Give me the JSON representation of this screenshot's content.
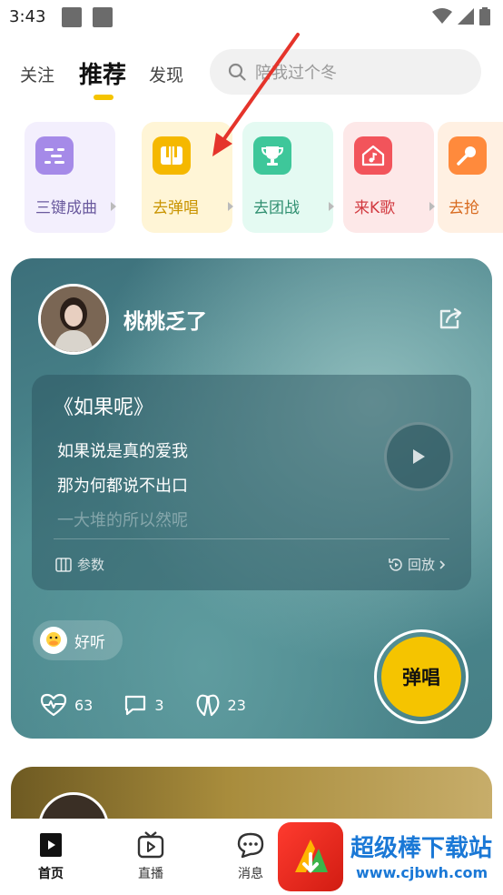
{
  "status_bar": {
    "time": "3:43"
  },
  "top_nav": {
    "tabs": [
      {
        "label": "关注",
        "active": false
      },
      {
        "label": "推荐",
        "active": true
      },
      {
        "label": "发现",
        "active": false
      }
    ],
    "search_placeholder": "陪我过个冬"
  },
  "quick_actions": [
    {
      "label": "三键成曲",
      "bg": "#f3effd",
      "icon_bg": "#a58ae8",
      "text_color": "#6a5a9e",
      "icon": "sliders-icon"
    },
    {
      "label": "去弹唱",
      "bg": "#fff5d6",
      "icon_bg": "#f5b800",
      "text_color": "#c99400",
      "icon": "piano-icon"
    },
    {
      "label": "去团战",
      "bg": "#e4faf2",
      "icon_bg": "#3ec79a",
      "text_color": "#2f8f70",
      "icon": "trophy-icon"
    },
    {
      "label": "来K歌",
      "bg": "#fde8e8",
      "icon_bg": "#f2545b",
      "text_color": "#d23a40",
      "icon": "home-music-icon"
    },
    {
      "label": "去抢",
      "bg": "#fff0e2",
      "icon_bg": "#ff8a3c",
      "text_color": "#d86a1e",
      "icon": "mic-icon"
    }
  ],
  "card": {
    "username": "桃桃乏了",
    "song_title": "《如果呢》",
    "lyrics": [
      "如果说是真的爱我",
      "那为何都说不出口",
      "一大堆的所以然呢"
    ],
    "params_label": "参数",
    "replay_label": "回放",
    "tag_label": "好听",
    "sing_label": "弹唱",
    "stats": {
      "likes": "63",
      "comments": "3",
      "gifts": "23"
    }
  },
  "bottom_nav": [
    {
      "label": "首页",
      "active": true
    },
    {
      "label": "直播",
      "active": false
    },
    {
      "label": "消息",
      "active": false
    }
  ],
  "colors": {
    "accent": "#f5c400",
    "annotation_arrow": "#e5342b"
  }
}
